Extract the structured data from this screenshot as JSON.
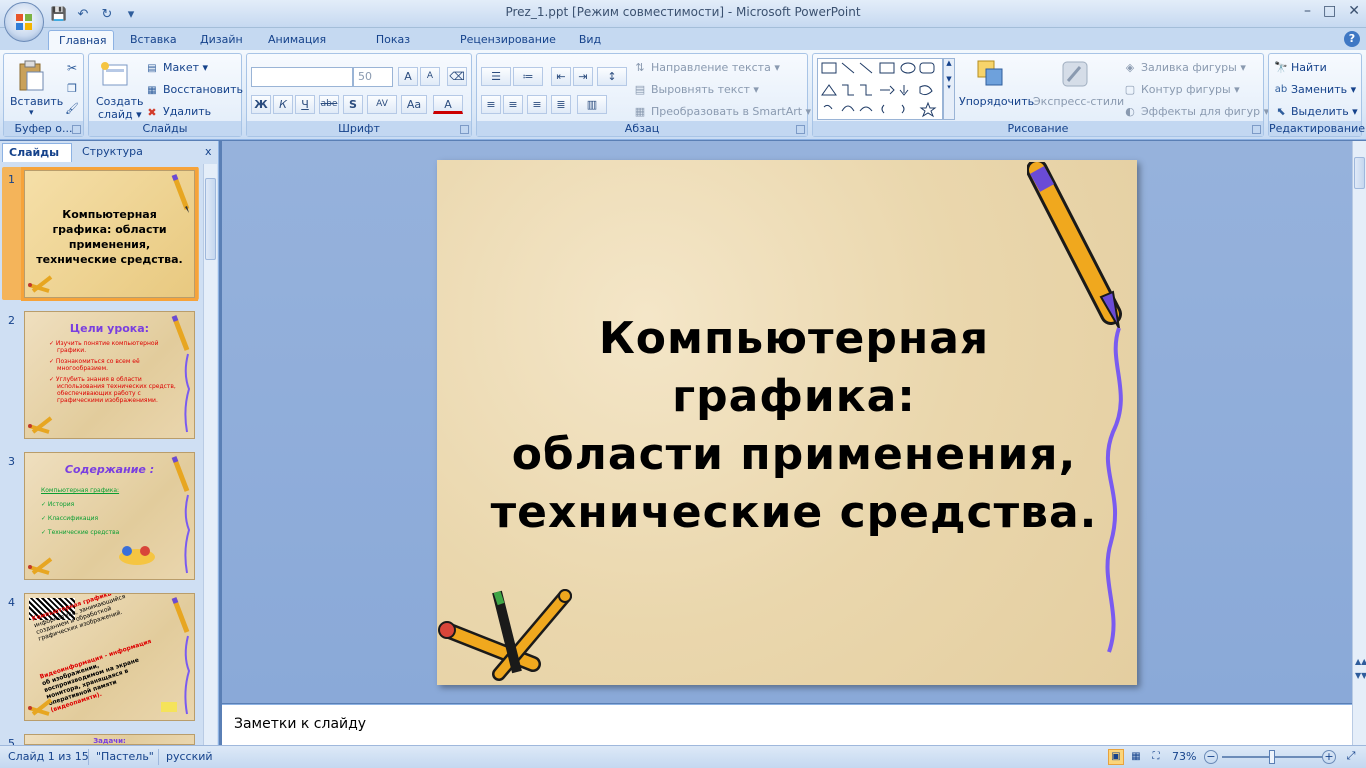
{
  "window": {
    "title": "Prez_1.ppt [Режим совместимости] - Microsoft PowerPoint",
    "controls": [
      "–",
      "□",
      "✕"
    ]
  },
  "qat": {
    "save": "💾",
    "undo": "↶",
    "redo": "↻",
    "more": "▾"
  },
  "tabs": [
    {
      "label": "Главная",
      "active": true
    },
    {
      "label": "Вставка"
    },
    {
      "label": "Дизайн"
    },
    {
      "label": "Анимация"
    },
    {
      "label": "Показ слайдов"
    },
    {
      "label": "Рецензирование"
    },
    {
      "label": "Вид"
    }
  ],
  "ribbon": {
    "clipboard": {
      "label": "Буфер о...",
      "paste": "Вставить",
      "paste_arrow": "▾"
    },
    "slides": {
      "label": "Слайды",
      "new_slide": "Создать",
      "new_slide2": "слайд ▾",
      "layout": "Макет ▾",
      "reset": "Восстановить",
      "delete": "Удалить"
    },
    "font": {
      "label": "Шрифт",
      "font_name": "",
      "font_size": "50",
      "bold": "Ж",
      "italic": "К",
      "underline": "Ч",
      "strike": "abe",
      "shadow": "S",
      "spacing": "AV",
      "case": "Aa",
      "color": "A",
      "grow": "A",
      "shrink": "A"
    },
    "paragraph": {
      "label": "Абзац",
      "text_direction": "Направление текста ▾",
      "align_text": "Выровнять текст ▾",
      "smartart": "Преобразовать в SmartArt ▾"
    },
    "drawing": {
      "label": "Рисование",
      "arrange": "Упорядочить",
      "quick_styles": "Экспресс-стили",
      "fill": "Заливка фигуры ▾",
      "outline": "Контур фигуры ▾",
      "effects": "Эффекты для фигур ▾"
    },
    "editing": {
      "label": "Редактирование",
      "find": "Найти",
      "replace": "Заменить ▾",
      "select": "Выделить ▾"
    }
  },
  "pane": {
    "tab_slides": "Слайды",
    "tab_outline": "Структура",
    "close": "x",
    "thumbs": [
      {
        "num": "1",
        "title": "Компьютерная графика: области применения, технические средства."
      },
      {
        "num": "2",
        "title": "Цели урока:",
        "lines": [
          "✓ Изучить понятие компьютерной",
          "графики.",
          "✓ Познакомиться со всем её",
          "многообразием.",
          "✓ Углубить знания в области",
          "использования технических средств,",
          "обеспечивающих работу с",
          "графическими изображениями."
        ]
      },
      {
        "num": "3",
        "title": "Содержание :",
        "lines": [
          "Компьютерная графика:",
          "✓ История",
          "✓ Классификация",
          "✓ Технические средства"
        ]
      },
      {
        "num": "4",
        "lines": [
          "Компьютерная графика - раздел",
          "информатики, занимающийся",
          "созданием и обработкой",
          "графических изображений.",
          "Видеоинформация - информация",
          "об изображении,",
          "воспроизводимом на экране",
          "монитора, хранящаяся в",
          "оперативной памяти",
          "(видеопамяти)."
        ]
      },
      {
        "num": "5",
        "title": "Задачи:"
      }
    ]
  },
  "slide": {
    "title_lines": [
      "Компьютерная графика:",
      "области применения,",
      "технические средства."
    ]
  },
  "notes": {
    "placeholder": "Заметки к слайду"
  },
  "status": {
    "slide_info": "Слайд 1 из 15",
    "theme": "\"Пастель\"",
    "language": "русский",
    "zoom": "73%",
    "zoom_fraction": 0.5
  }
}
